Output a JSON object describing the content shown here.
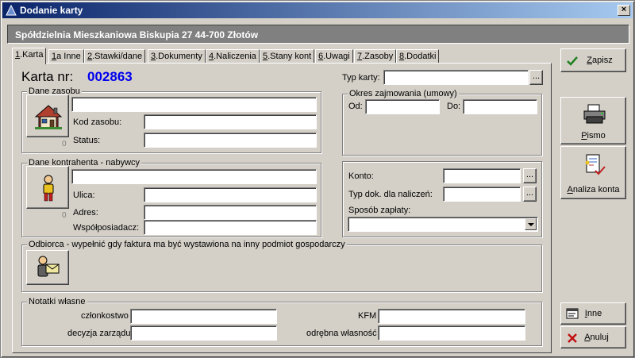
{
  "window": {
    "title": "Dodanie karty",
    "close_glyph": "×"
  },
  "header": {
    "text": "Spółdzielnia Mieszkaniowa Biskupia 27  44-700 Złotów"
  },
  "tabs": [
    {
      "num": "1",
      "label": ".Karta"
    },
    {
      "num": "1",
      "label": "a Inne"
    },
    {
      "num": "2",
      "label": ".Stawki/dane"
    },
    {
      "num": "3",
      "label": ".Dokumenty"
    },
    {
      "num": "4",
      "label": ".Naliczenia"
    },
    {
      "num": "5",
      "label": ".Stany kont"
    },
    {
      "num": "6",
      "label": ".Uwagi"
    },
    {
      "num": "7",
      "label": ".Zasoby"
    },
    {
      "num": "8",
      "label": ".Dodatki"
    }
  ],
  "karta": {
    "label": "Karta nr:",
    "number": "002863"
  },
  "typ_karty": {
    "label": "Typ karty:",
    "value": "",
    "btn": "..."
  },
  "dane_zasobu": {
    "title": "Dane zasobu",
    "name_value": "",
    "kod_label": "Kod zasobu:",
    "kod_value": "",
    "status_label": "Status:",
    "status_value": "",
    "counter": "0"
  },
  "okres": {
    "title": "Okres zajmowania (umowy)",
    "od_label": "Od:",
    "od_value": "",
    "do_label": "Do:",
    "do_value": ""
  },
  "kontrahent": {
    "title": "Dane kontrahenta - nabywcy",
    "name_value": "",
    "ulica_label": "Ulica:",
    "ulica_value": "",
    "adres_label": "Adres:",
    "adres_value": "",
    "wspol_label": "Współposiadacz:",
    "wspol_value": "",
    "counter": "0"
  },
  "konto": {
    "konto_label": "Konto:",
    "konto_value": "",
    "typ_dok_label": "Typ dok. dla naliczeń:",
    "typ_dok_value": "",
    "sposob_label": "Sposób zapłaty:",
    "sposob_value": "",
    "btn": "..."
  },
  "odbiorca": {
    "title": "Odbiorca - wypełnić gdy faktura ma być wystawiona na inny podmiot gospodarczy"
  },
  "notatki": {
    "title": "Notatki własne",
    "czlonkostwo_label": "członkostwo",
    "czlonkostwo_value": "",
    "decyzja_label": "decyzja zarządu",
    "decyzja_value": "",
    "kfm_label": "KFM",
    "kfm_value": "",
    "odrebna_label": "odrębna własność",
    "odrebna_value": ""
  },
  "sidebar": {
    "zapisz": {
      "first": "Z",
      "rest": "apisz"
    },
    "pismo": {
      "first": "P",
      "rest": "ismo"
    },
    "analiza": {
      "first": "A",
      "rest": "naliza konta"
    },
    "inne": {
      "first": "I",
      "rest": "nne"
    },
    "anuluj": {
      "first": "A",
      "rest": "nuluj"
    }
  },
  "colors": {
    "title_start": "#0a246a",
    "title_end": "#a6caf0",
    "karta_number": "#0000ee",
    "header_bg": "#808080"
  }
}
